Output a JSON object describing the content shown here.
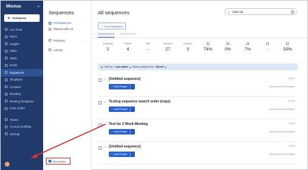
{
  "sidebar": {
    "logo": "Mixmax",
    "collapse": "«",
    "compose": "Compose",
    "items": [
      {
        "label": "Live Feed",
        "icon": "live-feed-icon"
      },
      {
        "label": "Rules",
        "icon": "rules-icon"
      },
      {
        "label": "Insights",
        "icon": "insights-icon"
      },
      {
        "label": "Dialer",
        "icon": "dialer-icon"
      },
      {
        "label": "Tasks",
        "icon": "tasks-icon"
      },
      {
        "label": "Drafts",
        "icon": "drafts-icon"
      },
      {
        "label": "Sequences",
        "icon": "sequences-icon",
        "active": true
      },
      {
        "label": "Templates",
        "icon": "templates-icon"
      },
      {
        "label": "Contacts",
        "icon": "contacts-icon"
      },
      {
        "label": "Branding",
        "icon": "branding-icon"
      },
      {
        "label": "Meeting Templates",
        "icon": "meeting-templates-icon"
      },
      {
        "label": "Links & files",
        "icon": "links-files-icon"
      }
    ],
    "bottom_items": [
      {
        "label": "Teams",
        "icon": "teams-icon"
      },
      {
        "label": "Account & Billing",
        "icon": "billing-icon"
      },
      {
        "label": "Settings",
        "icon": "settings-icon"
      }
    ]
  },
  "panel": {
    "title": "Sequences",
    "items": [
      {
        "label": "All sequences",
        "selected": true
      },
      {
        "label": "Shared with me",
        "selected": false
      }
    ],
    "personal": "Personal",
    "archive": "Archive",
    "new_folder": "New folder"
  },
  "main": {
    "title": "All sequences",
    "search_value": "folder:all",
    "new_sequence": "New Sequence",
    "tabs": [
      "SEQUENCES",
      "RECIPIENTS"
    ],
    "stats": [
      {
        "label": "Scheduled",
        "value": "2"
      },
      {
        "label": "Paused",
        "value": "4"
      },
      {
        "label": "Sent",
        "value": "-"
      },
      {
        "label": "Delivered",
        "value": "27"
      },
      {
        "label": "Bounced",
        "value": "0"
      },
      {
        "label": "",
        "value": "74%"
      },
      {
        "label": "",
        "value": "0%"
      },
      {
        "label": "",
        "value": "7%"
      },
      {
        "label": "",
        "value": "-"
      },
      {
        "label": "",
        "value": "50%"
      }
    ],
    "sort": {
      "prefix": "Sort by:",
      "value": "Last added",
      "middle": "Show analytics for:",
      "owner": "Myself"
    },
    "add_people": "Add People",
    "more": "···",
    "recipients_note": "Add recipients for analytics",
    "sequences": [
      {
        "name": "[Untitled sequence]",
        "date": "10/10/2"
      },
      {
        "name": "Testing sequence search order (copy)",
        "date": "10/10/2"
      },
      {
        "name": "Test for 2 Week Meeting",
        "date": "10/10/2"
      },
      {
        "name": "[Untitled sequence]",
        "date": "10/10/2"
      }
    ]
  },
  "colors": {
    "sidebar": "#1f3a6b",
    "accent": "#2a63c9",
    "highlight": "#d9332b"
  }
}
